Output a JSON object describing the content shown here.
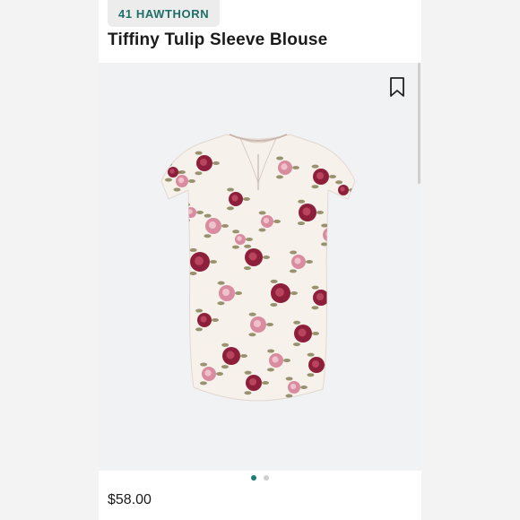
{
  "product": {
    "brand": "41 HAWTHORN",
    "title": "Tiffiny Tulip Sleeve Blouse",
    "price": "$58.00",
    "image_subject": "floral-blouse"
  },
  "carousel": {
    "total_dots": 2,
    "active_index": 0
  },
  "icons": {
    "bookmark": "bookmark-icon"
  },
  "colors": {
    "brand_text": "#1f6f68",
    "active_dot": "#1f7a73",
    "inactive_dot": "#cfcfcf",
    "rose_dark": "#8e1f3a",
    "rose_pink": "#d98ca0",
    "leaf": "#6f6a3a",
    "fabric": "#f7f1ec"
  }
}
